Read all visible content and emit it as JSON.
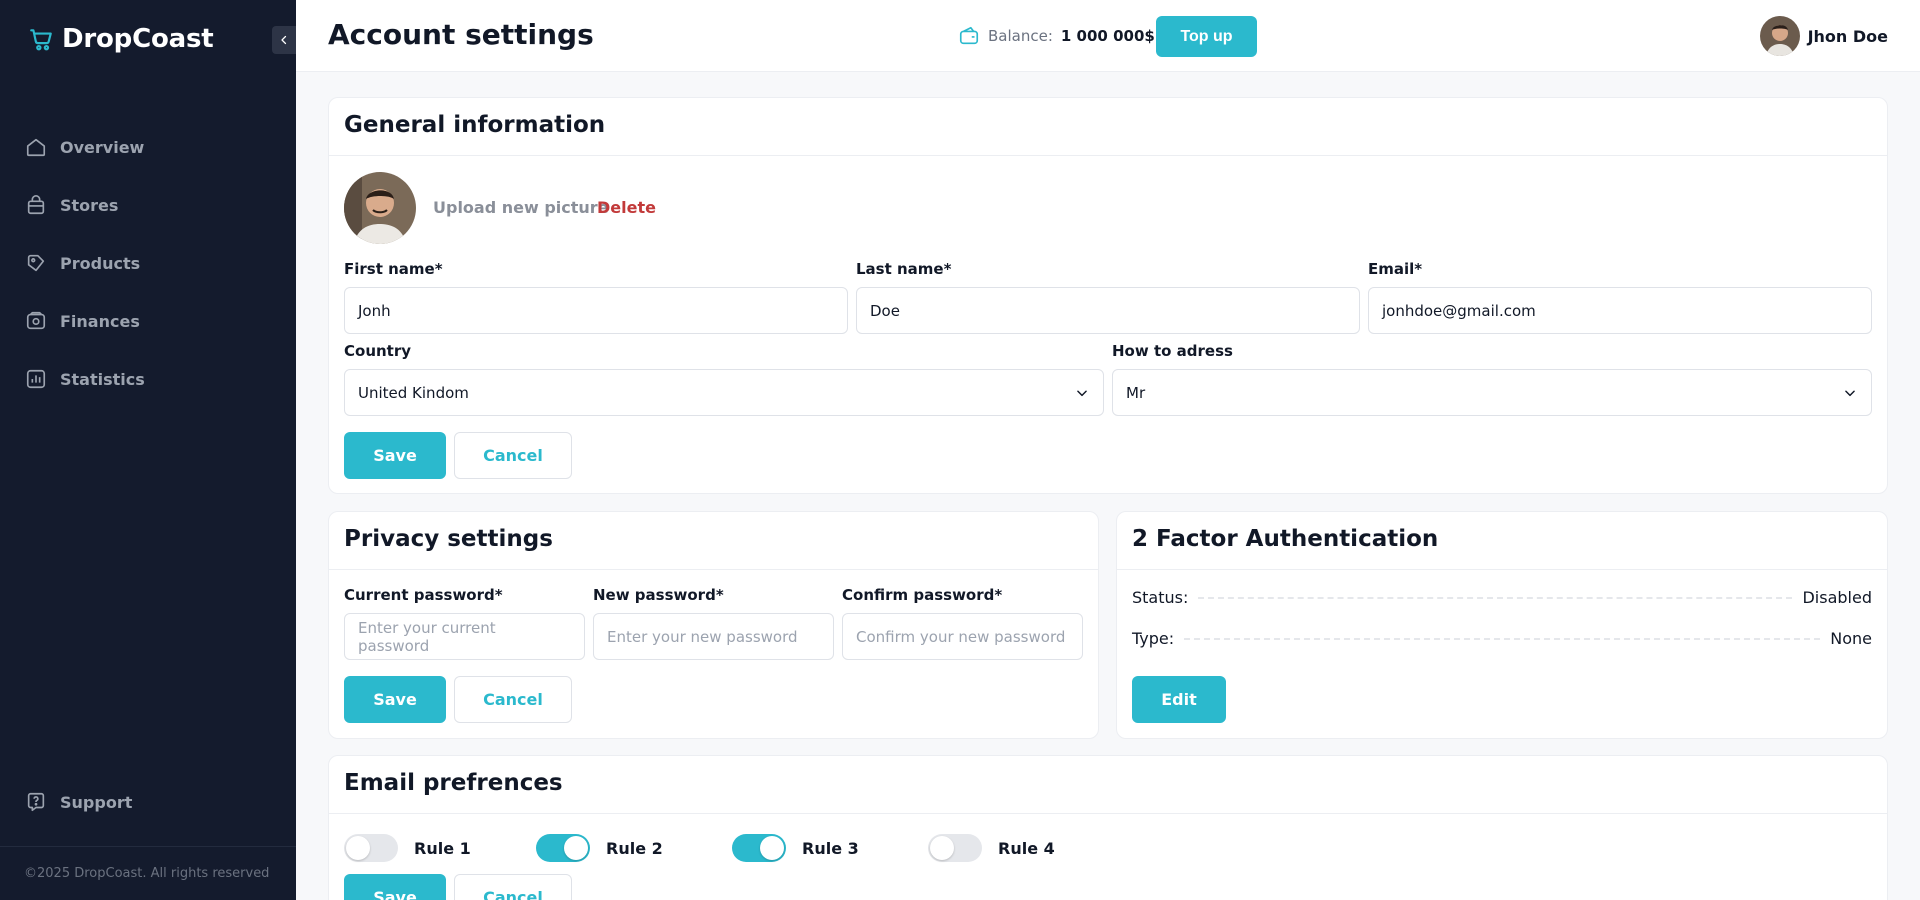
{
  "brand": {
    "name": "DropCoast"
  },
  "sidebar": {
    "items": [
      {
        "label": "Overview",
        "icon": "home-icon"
      },
      {
        "label": "Stores",
        "icon": "bag-icon"
      },
      {
        "label": "Products",
        "icon": "tag-icon"
      },
      {
        "label": "Finances",
        "icon": "wallet-icon"
      },
      {
        "label": "Statistics",
        "icon": "chart-icon"
      }
    ],
    "support_label": "Support",
    "copyright": "©2025 DropCoast. All rights reserved"
  },
  "header": {
    "title": "Account settings",
    "balance_label": "Balance:",
    "balance_value": "1 000 000$",
    "topup_label": "Top up",
    "user_name": "Jhon Doe"
  },
  "general": {
    "title": "General information",
    "upload_label": "Upload new picture",
    "delete_label": "Delete",
    "first_name_label": "First name*",
    "first_name_value": "Jonh",
    "last_name_label": "Last name*",
    "last_name_value": "Doe",
    "email_label": "Email*",
    "email_value": "jonhdoe@gmail.com",
    "country_label": "Country",
    "country_value": "United Kindom",
    "address_label": "How to adress",
    "address_value": "Mr",
    "save_label": "Save",
    "cancel_label": "Cancel"
  },
  "privacy": {
    "title": "Privacy settings",
    "current_label": "Current password*",
    "current_placeholder": "Enter your current password",
    "new_label": "New password*",
    "new_placeholder": "Enter your new password",
    "confirm_label": "Confirm password*",
    "confirm_placeholder": "Confirm your new password",
    "save_label": "Save",
    "cancel_label": "Cancel"
  },
  "twofa": {
    "title": "2 Factor Authentication",
    "status_label": "Status:",
    "status_value": "Disabled",
    "type_label": "Type:",
    "type_value": "None",
    "edit_label": "Edit"
  },
  "email_prefs": {
    "title": "Email prefrences",
    "rules": [
      {
        "label": "Rule 1",
        "enabled": false
      },
      {
        "label": "Rule 2",
        "enabled": true
      },
      {
        "label": "Rule 3",
        "enabled": true
      },
      {
        "label": "Rule 4",
        "enabled": false
      }
    ],
    "save_label": "Save",
    "cancel_label": "Cancel"
  },
  "colors": {
    "accent": "#2bb9cd",
    "sidebar_bg": "#141b2d",
    "danger": "#c23a3a"
  }
}
